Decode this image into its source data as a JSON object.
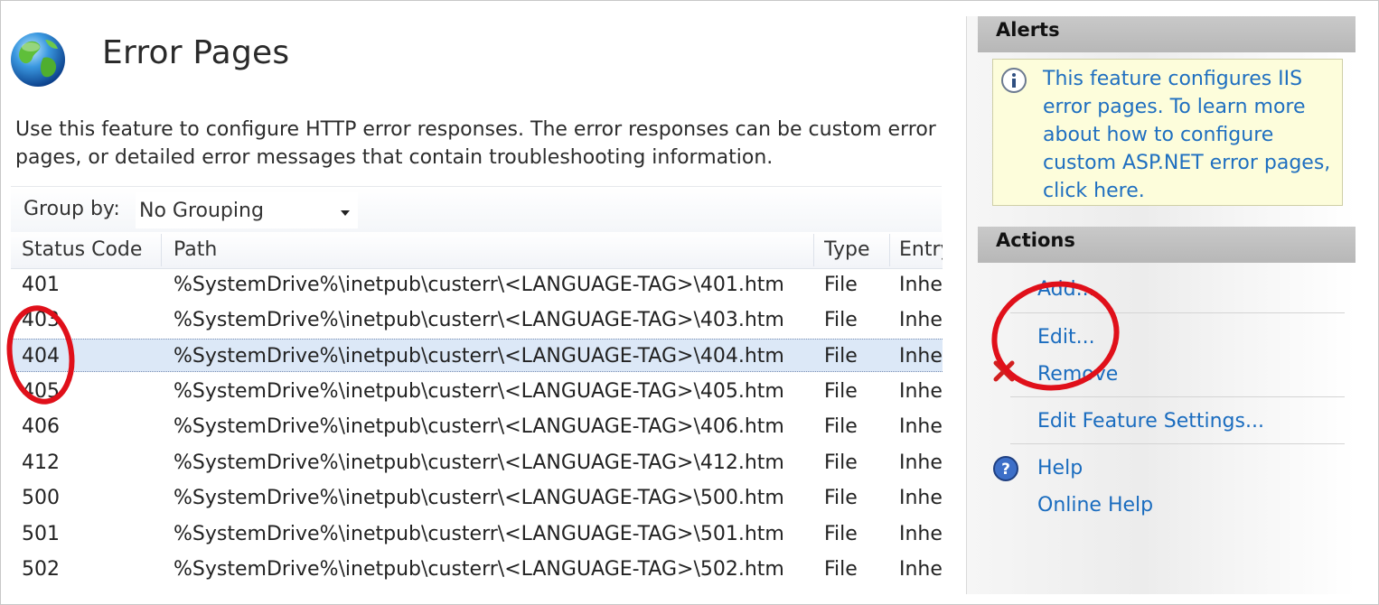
{
  "header": {
    "title": "Error Pages",
    "description": "Use this feature to configure HTTP error responses. The error responses can be custom error pages, or detailed error messages that contain troubleshooting information."
  },
  "groupby": {
    "label": "Group by:",
    "value": "No Grouping"
  },
  "table": {
    "columns": [
      "Status Code",
      "Path",
      "Type",
      "Entry"
    ],
    "rows": [
      {
        "code": "401",
        "path": "%SystemDrive%\\inetpub\\custerr\\<LANGUAGE-TAG>\\401.htm",
        "type": "File",
        "entry": "Inherited"
      },
      {
        "code": "403",
        "path": "%SystemDrive%\\inetpub\\custerr\\<LANGUAGE-TAG>\\403.htm",
        "type": "File",
        "entry": "Inherited"
      },
      {
        "code": "404",
        "path": "%SystemDrive%\\inetpub\\custerr\\<LANGUAGE-TAG>\\404.htm",
        "type": "File",
        "entry": "Inherited"
      },
      {
        "code": "405",
        "path": "%SystemDrive%\\inetpub\\custerr\\<LANGUAGE-TAG>\\405.htm",
        "type": "File",
        "entry": "Inherited"
      },
      {
        "code": "406",
        "path": "%SystemDrive%\\inetpub\\custerr\\<LANGUAGE-TAG>\\406.htm",
        "type": "File",
        "entry": "Inherited"
      },
      {
        "code": "412",
        "path": "%SystemDrive%\\inetpub\\custerr\\<LANGUAGE-TAG>\\412.htm",
        "type": "File",
        "entry": "Inherited"
      },
      {
        "code": "500",
        "path": "%SystemDrive%\\inetpub\\custerr\\<LANGUAGE-TAG>\\500.htm",
        "type": "File",
        "entry": "Inherited"
      },
      {
        "code": "501",
        "path": "%SystemDrive%\\inetpub\\custerr\\<LANGUAGE-TAG>\\501.htm",
        "type": "File",
        "entry": "Inherited"
      },
      {
        "code": "502",
        "path": "%SystemDrive%\\inetpub\\custerr\\<LANGUAGE-TAG>\\502.htm",
        "type": "File",
        "entry": "Inherited"
      }
    ],
    "selected_row": 2
  },
  "alerts": {
    "title": "Alerts",
    "message": "This feature configures IIS error pages. To learn more about how to configure custom ASP.NET error pages, click here."
  },
  "actions": {
    "title": "Actions",
    "add": "Add...",
    "edit": "Edit...",
    "remove": "Remove",
    "edit_feature_settings": "Edit Feature Settings...",
    "help": "Help",
    "online_help": "Online Help"
  },
  "icons": {
    "page_icon": "globe-icon",
    "alert_icon": "info-icon",
    "remove_icon": "red-x-icon",
    "help_icon": "help-icon"
  },
  "colors": {
    "link": "#1a6cbf",
    "selected_row": "#dce8f7",
    "alert_bg": "#fdfddb",
    "annotation": "#e0101a"
  }
}
